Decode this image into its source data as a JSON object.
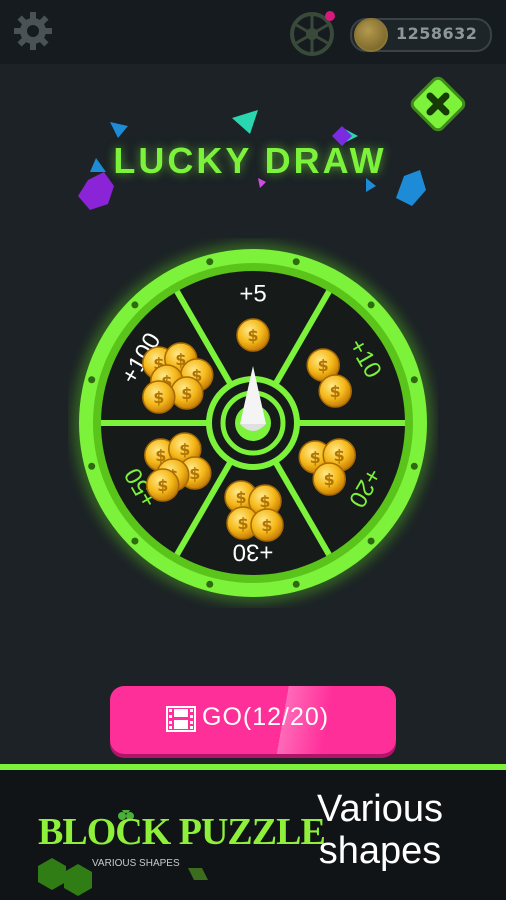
{
  "topbar": {
    "coin_balance": "1258632",
    "settings_icon": "gear-icon",
    "lucky_wheel_icon": "wheel-icon",
    "coin_icon": "coin-icon"
  },
  "dialog": {
    "title": "LUCKY DRAW",
    "close_icon": "close-icon",
    "wheel_segments": [
      {
        "label": "+5",
        "coins": 1
      },
      {
        "label": "+10",
        "coins": 2
      },
      {
        "label": "+20",
        "coins": 3
      },
      {
        "label": "+30",
        "coins": 4
      },
      {
        "label": "+50",
        "coins": 5
      },
      {
        "label": "+100",
        "coins": 6
      }
    ],
    "go_button": {
      "label": "GO(12/20)",
      "icon": "film-icon"
    }
  },
  "footer": {
    "logo_text": "BLOCK PUZZLE",
    "logo_subtitle": "VARIOUS SHAPES",
    "tagline_line1": "Various",
    "tagline_line2": "shapes"
  },
  "colors": {
    "accent_green": "#7cf23a",
    "button_pink": "#ff2f9a",
    "background": "#1c2226"
  }
}
